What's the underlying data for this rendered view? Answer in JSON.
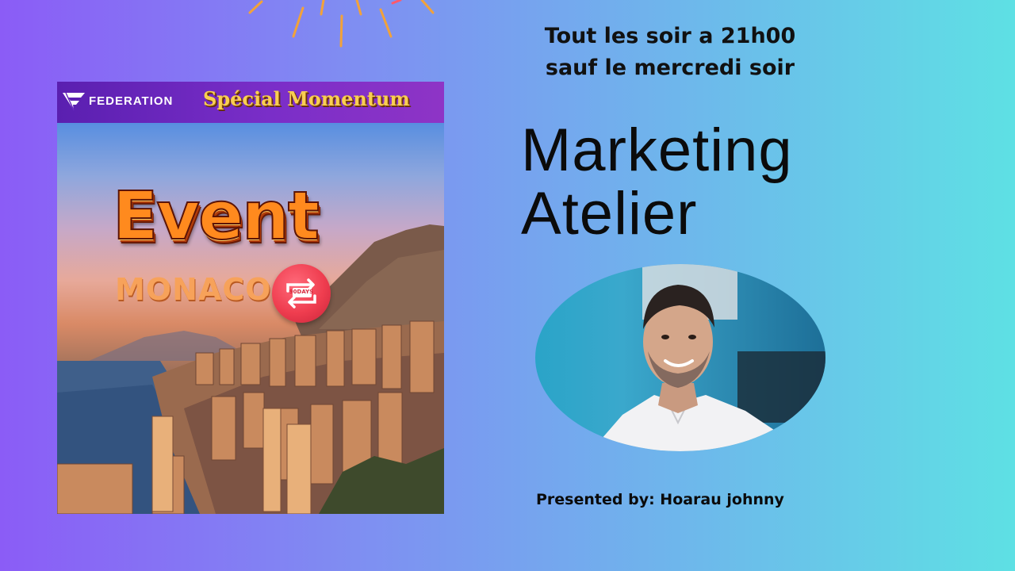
{
  "poster": {
    "brand": "FEDERATION",
    "banner_title": "Spécial Momentum",
    "headline": "Event",
    "location": "MONACO",
    "badge_label": "90DAYS"
  },
  "schedule": {
    "line1": "Tout les soir a 21h00",
    "line2": "sauf le mercredi soir"
  },
  "title": {
    "line1": "Marketing",
    "line2": "Atelier"
  },
  "presenter": "Presented by: Hoarau johnny",
  "colors": {
    "gradient_left": "#8b5cf6",
    "gradient_right": "#5ee0e4",
    "banner": "#6a28c0",
    "banner_title": "#f8cf52",
    "headline": "#ff8a1e",
    "badge": "#ef3d4f"
  },
  "icons": [
    "federation-logo-icon",
    "repeat-arrows-icon",
    "firework-icon"
  ]
}
